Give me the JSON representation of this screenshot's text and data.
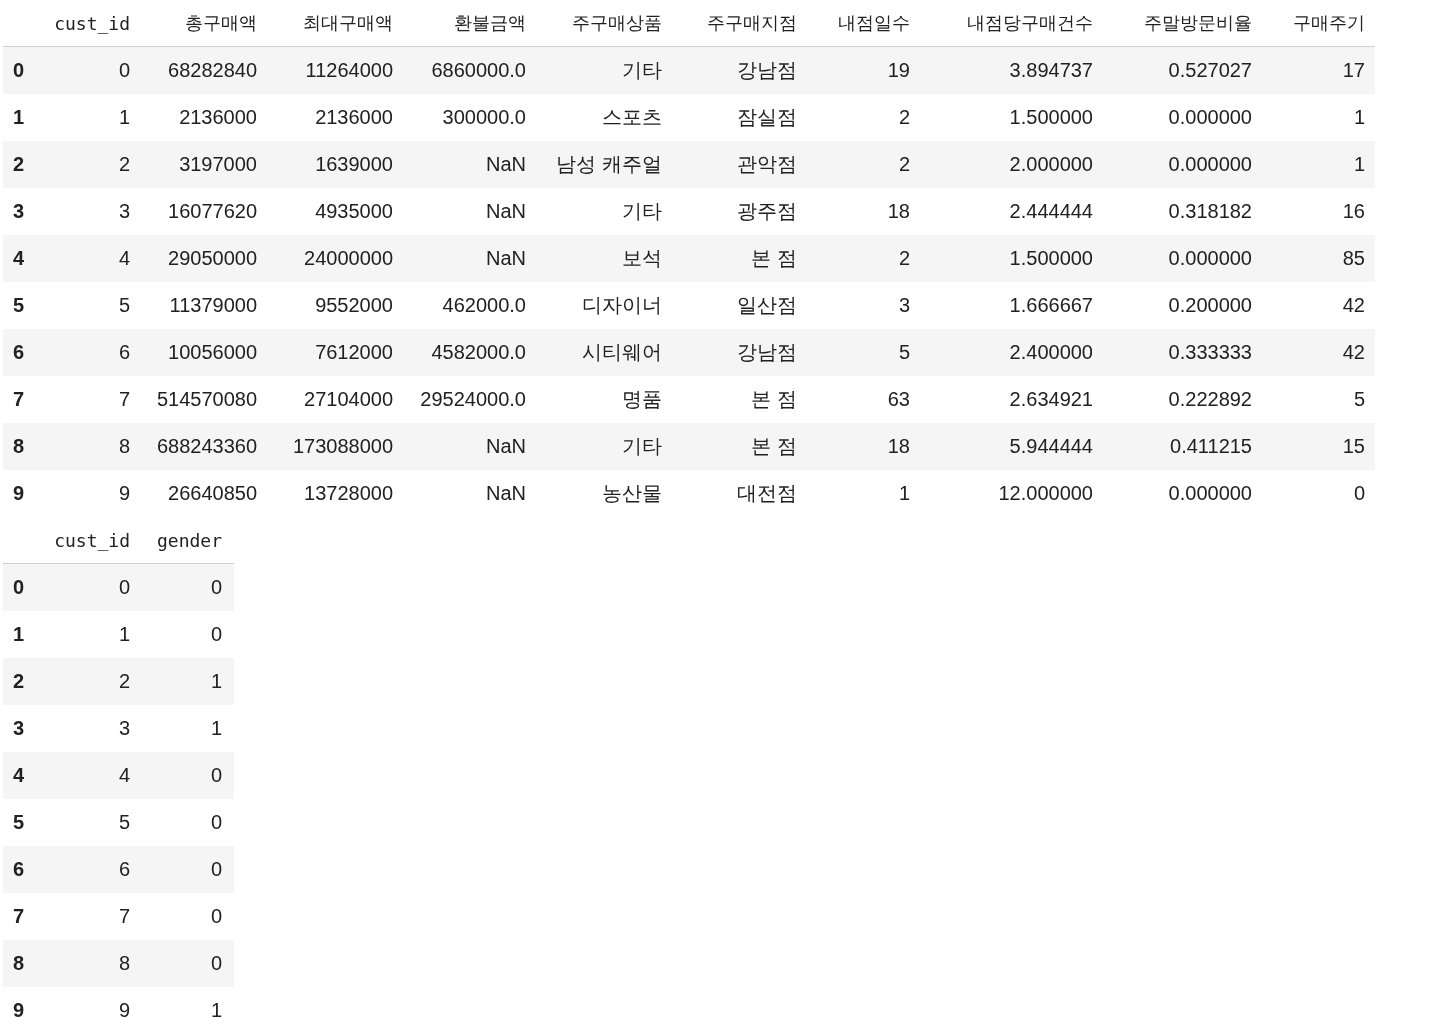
{
  "tables": [
    {
      "columns": [
        "cust_id",
        "총구매액",
        "최대구매액",
        "환불금액",
        "주구매상품",
        "주구매지점",
        "내점일수",
        "내점당구매건수",
        "주말방문비율",
        "구매주기"
      ],
      "rows": [
        {
          "index": "0",
          "cells": [
            "0",
            "68282840",
            "11264000",
            "6860000.0",
            "기타",
            "강남점",
            "19",
            "3.894737",
            "0.527027",
            "17"
          ]
        },
        {
          "index": "1",
          "cells": [
            "1",
            "2136000",
            "2136000",
            "300000.0",
            "스포츠",
            "잠실점",
            "2",
            "1.500000",
            "0.000000",
            "1"
          ]
        },
        {
          "index": "2",
          "cells": [
            "2",
            "3197000",
            "1639000",
            "NaN",
            "남성 캐주얼",
            "관악점",
            "2",
            "2.000000",
            "0.000000",
            "1"
          ]
        },
        {
          "index": "3",
          "cells": [
            "3",
            "16077620",
            "4935000",
            "NaN",
            "기타",
            "광주점",
            "18",
            "2.444444",
            "0.318182",
            "16"
          ]
        },
        {
          "index": "4",
          "cells": [
            "4",
            "29050000",
            "24000000",
            "NaN",
            "보석",
            "본 점",
            "2",
            "1.500000",
            "0.000000",
            "85"
          ]
        },
        {
          "index": "5",
          "cells": [
            "5",
            "11379000",
            "9552000",
            "462000.0",
            "디자이너",
            "일산점",
            "3",
            "1.666667",
            "0.200000",
            "42"
          ]
        },
        {
          "index": "6",
          "cells": [
            "6",
            "10056000",
            "7612000",
            "4582000.0",
            "시티웨어",
            "강남점",
            "5",
            "2.400000",
            "0.333333",
            "42"
          ]
        },
        {
          "index": "7",
          "cells": [
            "7",
            "514570080",
            "27104000",
            "29524000.0",
            "명품",
            "본 점",
            "63",
            "2.634921",
            "0.222892",
            "5"
          ]
        },
        {
          "index": "8",
          "cells": [
            "8",
            "688243360",
            "173088000",
            "NaN",
            "기타",
            "본 점",
            "18",
            "5.944444",
            "0.411215",
            "15"
          ]
        },
        {
          "index": "9",
          "cells": [
            "9",
            "26640850",
            "13728000",
            "NaN",
            "농산물",
            "대전점",
            "1",
            "12.000000",
            "0.000000",
            "0"
          ]
        }
      ]
    },
    {
      "columns": [
        "cust_id",
        "gender"
      ],
      "rows": [
        {
          "index": "0",
          "cells": [
            "0",
            "0"
          ]
        },
        {
          "index": "1",
          "cells": [
            "1",
            "0"
          ]
        },
        {
          "index": "2",
          "cells": [
            "2",
            "1"
          ]
        },
        {
          "index": "3",
          "cells": [
            "3",
            "1"
          ]
        },
        {
          "index": "4",
          "cells": [
            "4",
            "0"
          ]
        },
        {
          "index": "5",
          "cells": [
            "5",
            "0"
          ]
        },
        {
          "index": "6",
          "cells": [
            "6",
            "0"
          ]
        },
        {
          "index": "7",
          "cells": [
            "7",
            "0"
          ]
        },
        {
          "index": "8",
          "cells": [
            "8",
            "0"
          ]
        },
        {
          "index": "9",
          "cells": [
            "9",
            "1"
          ]
        }
      ]
    }
  ]
}
